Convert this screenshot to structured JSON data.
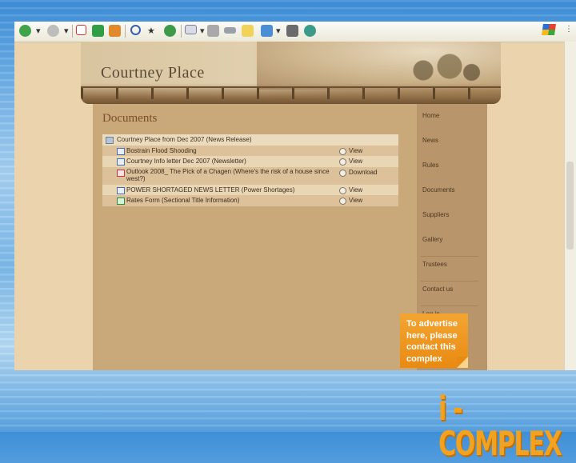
{
  "site": {
    "title": "Courtney Place"
  },
  "documents": {
    "heading": "Documents",
    "rows": [
      {
        "name": "Courtney Place from Dec 2007 (News Release)",
        "action": "",
        "type": "folder"
      },
      {
        "name": "Bostrain Flood Shooding",
        "action": "View",
        "type": "doc"
      },
      {
        "name": "Courtney Info letter Dec 2007 (Newsletter)",
        "action": "View",
        "type": "doc"
      },
      {
        "name": "Outlook 2008_ The Pick of a Chagen (Where's the risk of a house since west?)",
        "action": "Download",
        "type": "pdf"
      },
      {
        "name": "POWER SHORTAGED NEWS LETTER (Power Shortages)",
        "action": "View",
        "type": "doc"
      },
      {
        "name": "Rates Form (Sectional Title Information)",
        "action": "View",
        "type": "xls"
      }
    ]
  },
  "nav": {
    "items": [
      "Home",
      "News",
      "Rules",
      "Documents",
      "Suppliers",
      "Gallery",
      "Trustees",
      "Contact us",
      "Log in"
    ]
  },
  "ad": {
    "line1": "To advertise",
    "line2": "here, please",
    "line3": "contact this",
    "line4": "complex"
  },
  "brand": {
    "text": "i - COMPLEX"
  },
  "colors": {
    "accent": "#f2a21e",
    "page": "#c9a87a",
    "nav": "#b8956a"
  },
  "toolbar_icons": [
    "back-icon",
    "forward-icon",
    "stop-icon",
    "refresh-icon",
    "home-icon",
    "search-icon",
    "favorites-icon",
    "history-icon",
    "mail-icon",
    "print-icon",
    "edit-icon",
    "folder-icon",
    "messenger-icon",
    "research-icon",
    "people-icon"
  ]
}
